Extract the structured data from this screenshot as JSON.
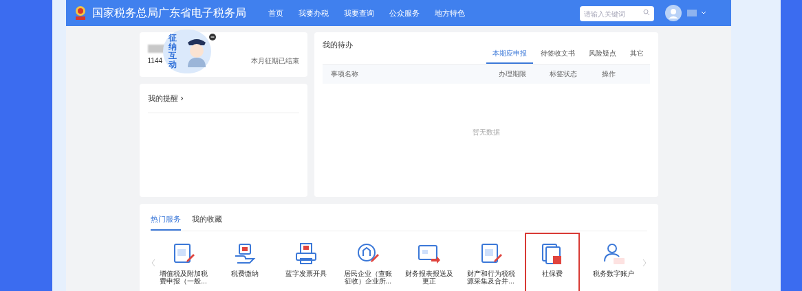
{
  "header": {
    "title": "国家税务总局广东省电子税务局",
    "nav": [
      {
        "label": "首页"
      },
      {
        "label": "我要办税"
      },
      {
        "label": "我要查询"
      },
      {
        "label": "公众服务"
      },
      {
        "label": "地方特色"
      }
    ],
    "search": {
      "placeholder": "请输入关键词"
    }
  },
  "account_card": {
    "id_prefix": "1144",
    "status": "本月征期已结束",
    "widget": {
      "label": "征纳互动"
    }
  },
  "reminders": {
    "title": "我的提醒",
    "arrow": "›"
  },
  "todo": {
    "title": "我的待办",
    "tabs": [
      {
        "label": "本期应申报",
        "selected": true
      },
      {
        "label": "待签收文书",
        "selected": false
      },
      {
        "label": "风险疑点",
        "selected": false
      },
      {
        "label": "其它",
        "selected": false
      }
    ],
    "columns": [
      "事项名称",
      "办理期限",
      "标签状态",
      "操作"
    ],
    "empty": "暂无数据"
  },
  "services": {
    "tabs": [
      {
        "label": "热门服务",
        "selected": true
      },
      {
        "label": "我的收藏",
        "selected": false
      }
    ],
    "items": [
      {
        "label": "增值税及附加税费申报（一般...",
        "highlighted": false
      },
      {
        "label": "税费缴纳",
        "highlighted": false
      },
      {
        "label": "蓝字发票开具",
        "highlighted": false
      },
      {
        "label": "居民企业（查账征收）企业所...",
        "highlighted": false
      },
      {
        "label": "财务报表报送及更正",
        "highlighted": false
      },
      {
        "label": "财产和行为税税源采集及合并...",
        "highlighted": false
      },
      {
        "label": "社保费",
        "highlighted": true
      },
      {
        "label": "税务数字账户",
        "highlighted": false
      }
    ]
  }
}
